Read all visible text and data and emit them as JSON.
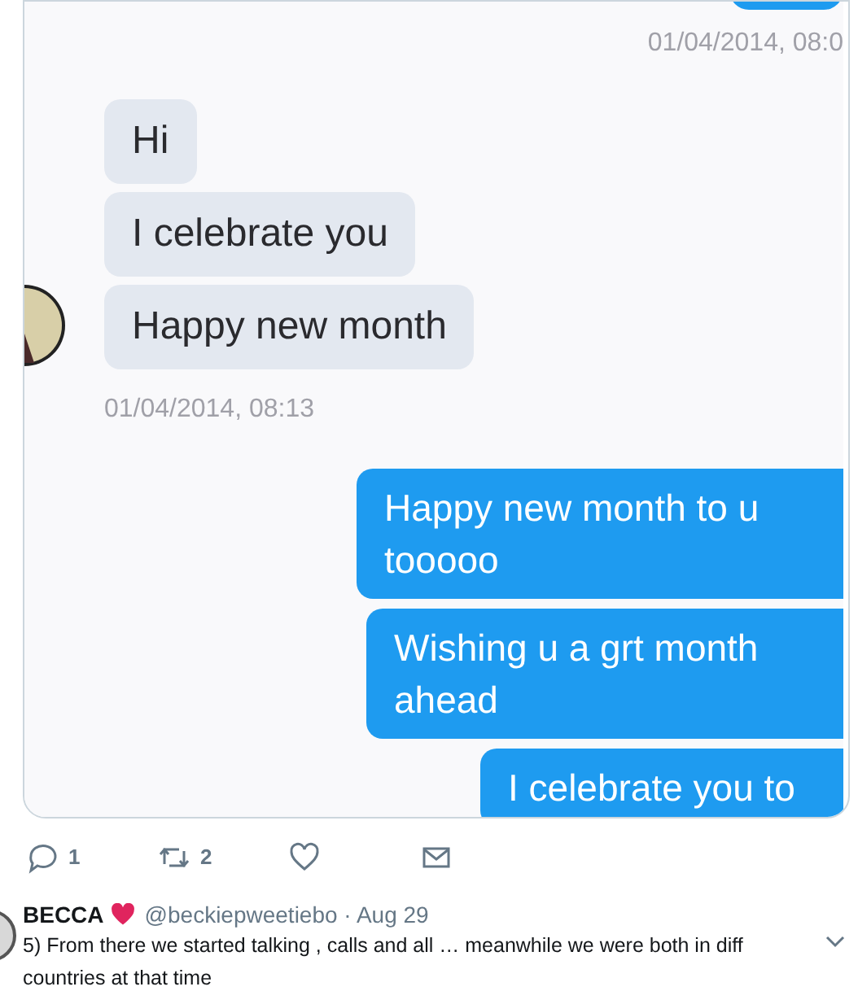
{
  "chat": [
    {
      "kind": "sent_time",
      "text": "01/04/2014, 08:0"
    },
    {
      "kind": "incoming",
      "text": "Hi"
    },
    {
      "kind": "incoming",
      "text": "I celebrate you"
    },
    {
      "kind": "incoming",
      "text": "Happy new month",
      "avatar": true
    },
    {
      "kind": "received_time",
      "text": "01/04/2014, 08:13"
    },
    {
      "kind": "outgoing",
      "text": "Happy new month to u tooooo"
    },
    {
      "kind": "outgoing",
      "text": "Wishing u a grt month ahead"
    },
    {
      "kind": "outgoing",
      "text": "I celebrate you to"
    }
  ],
  "actions": [
    {
      "kind": "reply",
      "count": "1"
    },
    {
      "kind": "retweet",
      "count": "2"
    },
    {
      "kind": "like"
    },
    {
      "kind": "message"
    }
  ],
  "tweet": {
    "name": "BECCA",
    "handle": "@beckiepweetiebo · Aug 29",
    "text": "5) From there we started talking , calls and all … meanwhile we were both in diff countries at that time"
  }
}
